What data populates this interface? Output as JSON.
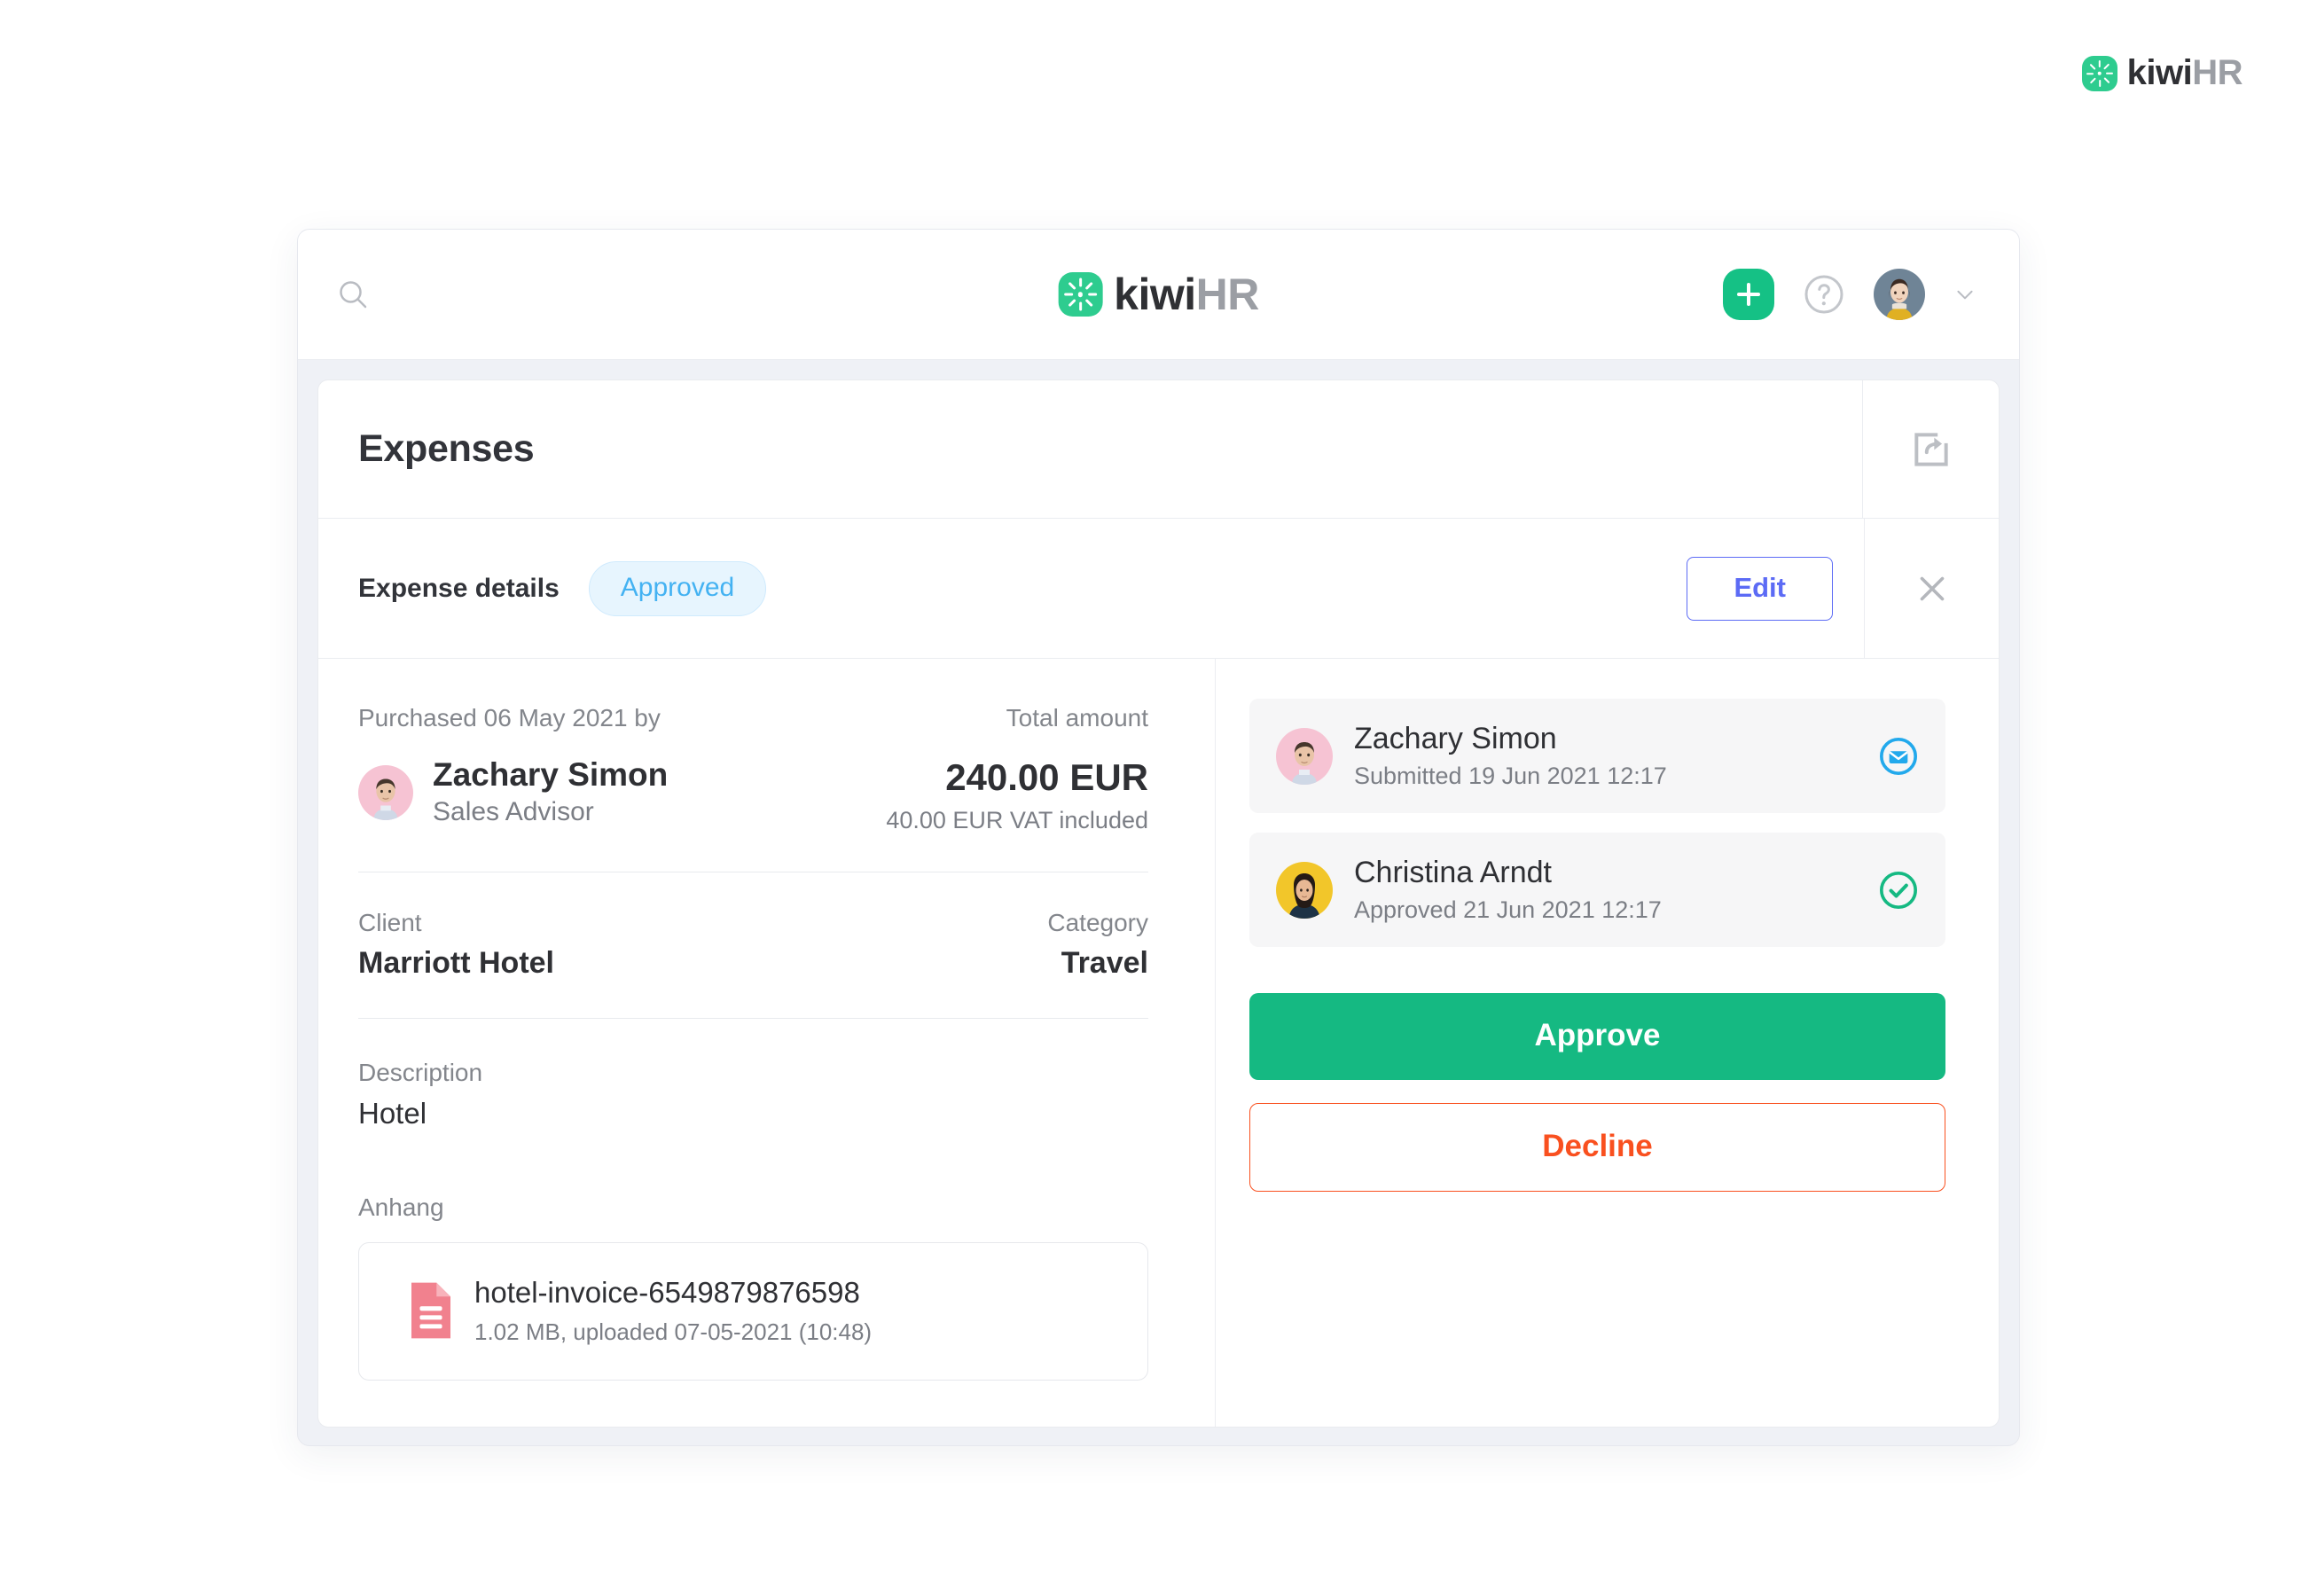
{
  "brand": {
    "name_primary": "kiwi",
    "name_secondary": "HR",
    "mark": "kiwi-starburst-icon",
    "color": "#2ecc8f"
  },
  "topbar": {
    "search_icon": "search-icon",
    "add_icon": "plus-icon",
    "help_icon": "question-circle-icon",
    "avatar": "user-avatar",
    "chevron_icon": "chevron-down-icon"
  },
  "card": {
    "title": "Expenses",
    "export_icon": "export-icon"
  },
  "details": {
    "title": "Expense details",
    "status": "Approved",
    "status_color": "#44b2f2",
    "edit_label": "Edit",
    "edit_color": "#5c6bf5",
    "close_icon": "close-icon"
  },
  "expense": {
    "purchased_label": "Purchased 06 May 2021 by",
    "purchaser_name": "Zachary Simon",
    "purchaser_role": "Sales Advisor",
    "total_label": "Total amount",
    "total_value": "240.00 EUR",
    "vat_note": "40.00 EUR VAT included",
    "client_label": "Client",
    "client_value": "Marriott Hotel",
    "category_label": "Category",
    "category_value": "Travel",
    "description_label": "Description",
    "description_value": "Hotel",
    "attachment_label": "Anhang",
    "attachment": {
      "icon": "document-icon",
      "name": "hotel-invoice-6549879876598",
      "meta": "1.02 MB, uploaded 07-05-2021 (10:48)"
    }
  },
  "approvals": [
    {
      "name": "Zachary Simon",
      "status_text": "Submitted 19 Jun 2021 12:17",
      "status_icon": "envelope-circle-icon",
      "status_color": "#22a9ec"
    },
    {
      "name": "Christina Arndt",
      "status_text": "Approved 21 Jun 2021 12:17",
      "status_icon": "check-circle-icon",
      "status_color": "#15b982"
    }
  ],
  "actions": {
    "approve_label": "Approve",
    "approve_color": "#15b982",
    "decline_label": "Decline",
    "decline_color": "#f9501f"
  }
}
